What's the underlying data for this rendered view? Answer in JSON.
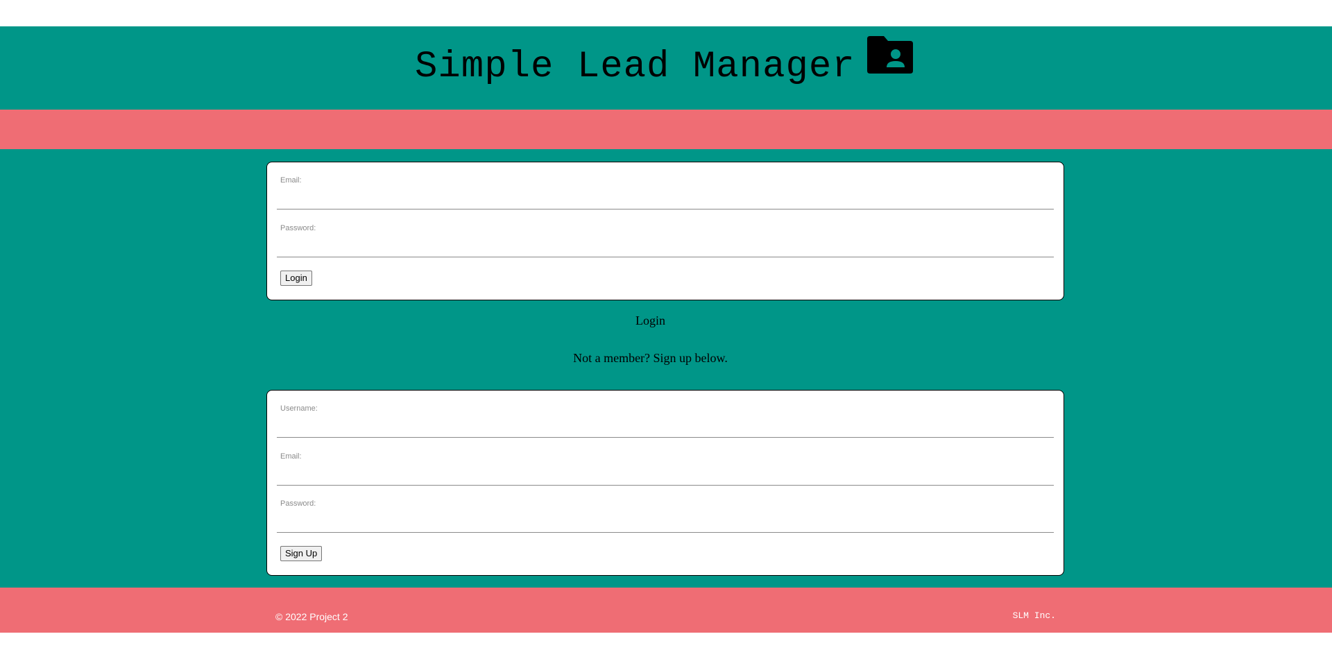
{
  "header": {
    "title": "Simple Lead Manager",
    "icon": "folder-user-icon"
  },
  "login_form": {
    "email_label": "Email:",
    "email_value": "",
    "password_label": "Password:",
    "password_value": "",
    "submit_label": "Login"
  },
  "login_link": "Login",
  "signup_prompt": "Not a member? Sign up below.",
  "signup_form": {
    "username_label": "Username:",
    "username_value": "",
    "email_label": "Email:",
    "email_value": "",
    "password_label": "Password:",
    "password_value": "",
    "submit_label": "Sign Up"
  },
  "footer": {
    "copyright": "© 2022 Project 2",
    "brand": "SLM Inc."
  },
  "colors": {
    "teal": "#009688",
    "coral": "#ef6d74"
  }
}
